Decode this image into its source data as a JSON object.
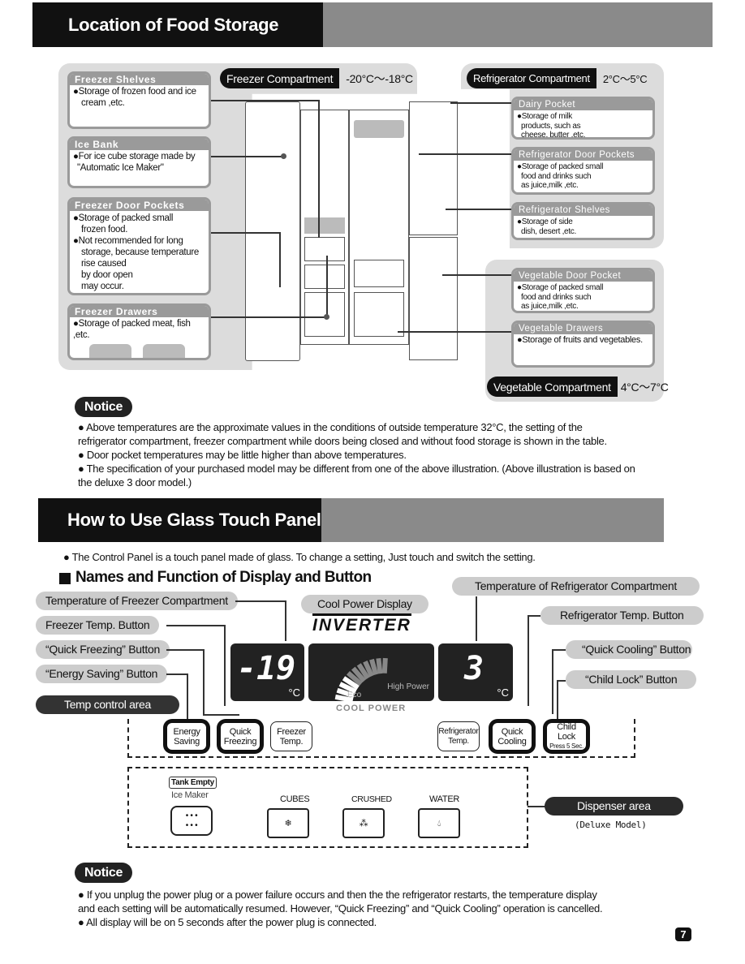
{
  "section1": {
    "title": "Location of Food Storage"
  },
  "freezer_compartment": {
    "label": "Freezer Compartment",
    "temp": "-20°C～-18°C"
  },
  "refrigerator_compartment": {
    "label": "Refrigerator Compartment",
    "temp": "2°C～5°C"
  },
  "vegetable_compartment": {
    "label": "Vegetable Compartment",
    "temp": "4°C～7°C"
  },
  "cards": [
    {
      "title": "Freezer Shelves",
      "lines": [
        "●Storage of frozen food and ice",
        "  cream ,etc."
      ]
    },
    {
      "title": "Ice Bank",
      "lines": [
        "●For ice cube storage made by",
        "  \"Automatic Ice Maker\""
      ]
    },
    {
      "title": "Freezer Door Pockets",
      "lines": [
        "●Storage of packed small",
        "  frozen food.",
        "●Not recommended for long",
        "  storage, because temperature",
        "  rise caused",
        "  by door open",
        "  may occur."
      ]
    },
    {
      "title": "Freezer Drawers",
      "lines": [
        "●Storage of packed meat, fish ,etc."
      ]
    },
    {
      "title": "Dairy Pocket",
      "lines": [
        "●Storage of milk",
        "  products, such as",
        "  cheese, butter ,etc."
      ]
    },
    {
      "title": "Refrigerator Door Pockets",
      "lines": [
        "●Storage of packed small",
        "  food and drinks such",
        "  as juice,milk ,etc."
      ]
    },
    {
      "title": "Refrigerator Shelves",
      "lines": [
        "●Storage of side",
        "  dish, desert ,etc."
      ]
    },
    {
      "title": "Vegetable Door Pocket",
      "lines": [
        "●Storage of packed small",
        "  food and drinks such",
        "  as juice,milk ,etc."
      ]
    },
    {
      "title": "Vegetable Drawers",
      "lines": [
        "●Storage of fruits and vegetables."
      ]
    }
  ],
  "notice1": {
    "label": "Notice",
    "lines": [
      "● Above temperatures are the approximate values in the conditions of outside temperature 32°C, the setting of the",
      "   refrigerator compartment, freezer compartment while doors being closed and without food storage is shown in the table.",
      "● Door pocket temperatures may be little higher than above temperatures.",
      "● The specification of your purchased model may be different from one of the above illustration. (Above illustration is based on",
      "   the deluxe 3 door model.)"
    ]
  },
  "section2": {
    "title": "How to Use Glass Touch Panel",
    "intro": "●  The Control Panel is a touch panel made of glass. To change a setting, Just touch and switch the setting.",
    "subtitle": "Names and Function of Display and Button"
  },
  "callouts": {
    "temp_freezer": "Temperature of Freezer Compartment",
    "freezer_temp_btn": "Freezer Temp. Button",
    "quick_freezing_btn": "“Quick Freezing” Button",
    "energy_saving_btn": "“Energy Saving” Button",
    "temp_control_area": "Temp control area",
    "cool_power_display": "Cool Power Display",
    "temp_refrigerator": "Temperature of Refrigerator Compartment",
    "refrigerator_temp_btn": "Refrigerator Temp. Button",
    "quick_cooling_btn": "“Quick Cooling” Button",
    "child_lock_btn": "“Child Lock” Button",
    "dispenser_area": "Dispenser area",
    "deluxe_model": "(Deluxe Model)"
  },
  "display": {
    "brand": "INVERTER",
    "freezer_value": "-19",
    "unit": "°C",
    "refrigerator_value": "3",
    "eco": "Eco",
    "high_power": "High Power",
    "cool_power": "COOL POWER"
  },
  "buttons": [
    {
      "l1": "Energy",
      "l2": "Saving"
    },
    {
      "l1": "Quick",
      "l2": "Freezing"
    },
    {
      "l1": "Freezer",
      "l2": "Temp."
    },
    {
      "l1": "Refrigerator",
      "l2": "Temp."
    },
    {
      "l1": "Quick",
      "l2": "Cooling"
    },
    {
      "l1": "Child Lock",
      "l2": "Press 5 Sec."
    }
  ],
  "dispenser": {
    "tank_empty": "Tank Empty",
    "ice_maker": "Ice Maker",
    "cubes": "CUBES",
    "crushed": "CRUSHED",
    "water": "WATER"
  },
  "notice2": {
    "label": "Notice",
    "lines": [
      "●  If you unplug  the power plug or a power failure occurs and then the the refrigerator restarts, the temperature display",
      "    and each setting will be automatically resumed. However, “Quick Freezing” and “Quick Cooling” operation is cancelled.",
      "●  All display will be on 5 seconds after the power plug is connected."
    ]
  },
  "page_number": "7"
}
